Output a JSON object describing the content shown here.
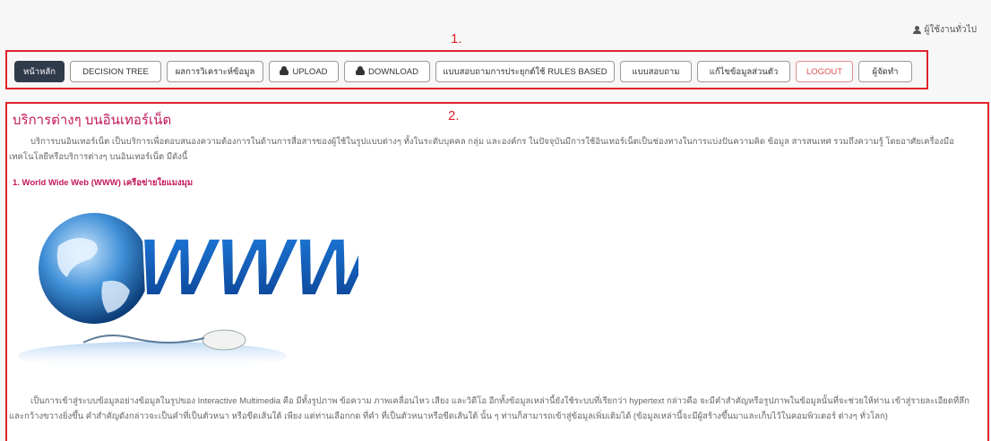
{
  "header": {
    "user_link": "ผู้ใช้งานทั่วไป",
    "user_icon": "user-icon"
  },
  "annotations": {
    "nav_label": "1.",
    "content_label": "2."
  },
  "nav": {
    "items": [
      {
        "label": "หน้าหลัก",
        "active": true
      },
      {
        "label": "DECISION TREE"
      },
      {
        "label": "ผลการวิเคราะห์ข้อมูล"
      },
      {
        "label": "UPLOAD",
        "icon": "cloud-upload-icon"
      },
      {
        "label": "DOWNLOAD",
        "icon": "cloud-download-icon"
      },
      {
        "label": "แบบสอบถามการประยุกต์ใช้ RULES BASED"
      },
      {
        "label": "แบบสอบถาม"
      },
      {
        "label": "แก้ไขข้อมูลส่วนตัว"
      },
      {
        "label": "LOGOUT",
        "style": "logout"
      },
      {
        "label": "ผู้จัดทำ"
      }
    ]
  },
  "content": {
    "title": "บริการต่างๆ บนอินเทอร์เน็ต",
    "intro": "บริการบนอินเทอร์เน็ต เป็นบริการเพื่อตอบสนองความต้องการในด้านการสื่อสารของผู้ใช้ในรูปแบบต่างๆ ทั้งในระดับบุคคล กลุ่ม และองค์กร ในปัจจุบันมีการใช้อินเทอร์เน็ตเป็นช่องทางในการแบ่งปันความคิด ข้อมูล สารสนเทศ รวมถึงความรู้ โดยอาศัยเครื่องมือ เทคโนโลยีหรือบริการต่างๆ บนอินเทอร์เน็ต มีดังนี้",
    "subheading": "1. World Wide Web (WWW) เครือข่ายใยแมงมุม",
    "hero_text": "WWW",
    "body": "เป็นการเข้าสู่ระบบข้อมูลอย่างข้อมูลในรูปของ Interactive Multimedia คือ มีทั้งรูปภาพ ข้อความ ภาพเคลื่อนไหว เสียง และวิดีโอ อีกทั้งข้อมูลเหล่านี้ยังใช้ระบบที่เรียกว่า hypertext กล่าวคือ จะมีคำสำคัญหรือรูปภาพในข้อมูลนั้นที่จะช่วยให้ท่าน เข้าสู่รายละเอียดที่ลึกและกว้างขวางยิ่งขึ้น คำสำคัญดังกล่าวจะเป็นคำที่เป็นตัวหนา หรือขีดเส้นใต้ เพียง แต่ท่านเลือกกด ที่คำ ที่เป็นตัวหนาหรือขีดเส้นใต้ นั้น ๆ ท่านก็สามารถเข้าสู่ข้อมูลเพิ่มเติมได้ (ข้อมูลเหล่านี้จะมีผู้สร้างขึ้นมาและเก็บไว้ในคอมพิวเตอร์ ต่างๆ ทั่วโลก)"
  },
  "colors": {
    "accent_red": "#e0242a",
    "title_pink": "#c2185b",
    "nav_active": "#2f3a4b"
  }
}
